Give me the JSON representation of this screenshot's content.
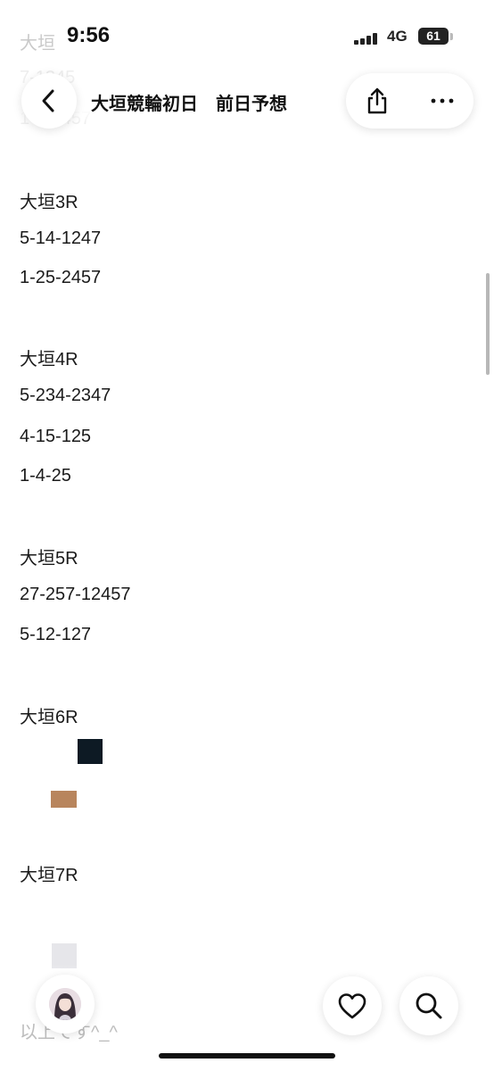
{
  "status_bar": {
    "time": "9:56",
    "network": "4G",
    "battery": "61"
  },
  "header": {
    "title": "大垣競輪初日　前日予想"
  },
  "ghost_lines": [
    "大垣",
    "7-1345",
    "1-45-457"
  ],
  "post": {
    "sections": [
      {
        "label": "大垣3R",
        "lines": [
          "5-14-1247",
          "1-25-2457"
        ]
      },
      {
        "label": "大垣4R",
        "lines": [
          "5-234-2347",
          "4-15-125",
          "1-4-25"
        ]
      },
      {
        "label": "大垣5R",
        "lines": [
          "27-257-12457",
          "5-12-127"
        ]
      },
      {
        "label": "大垣6R",
        "lines": []
      },
      {
        "label": "大垣7R",
        "lines": []
      }
    ],
    "footer": "以上です^_^"
  },
  "icons": {
    "back": "chevron-left-icon",
    "share": "share-icon",
    "more": "more-icon",
    "like": "heart-icon",
    "search": "search-icon"
  }
}
